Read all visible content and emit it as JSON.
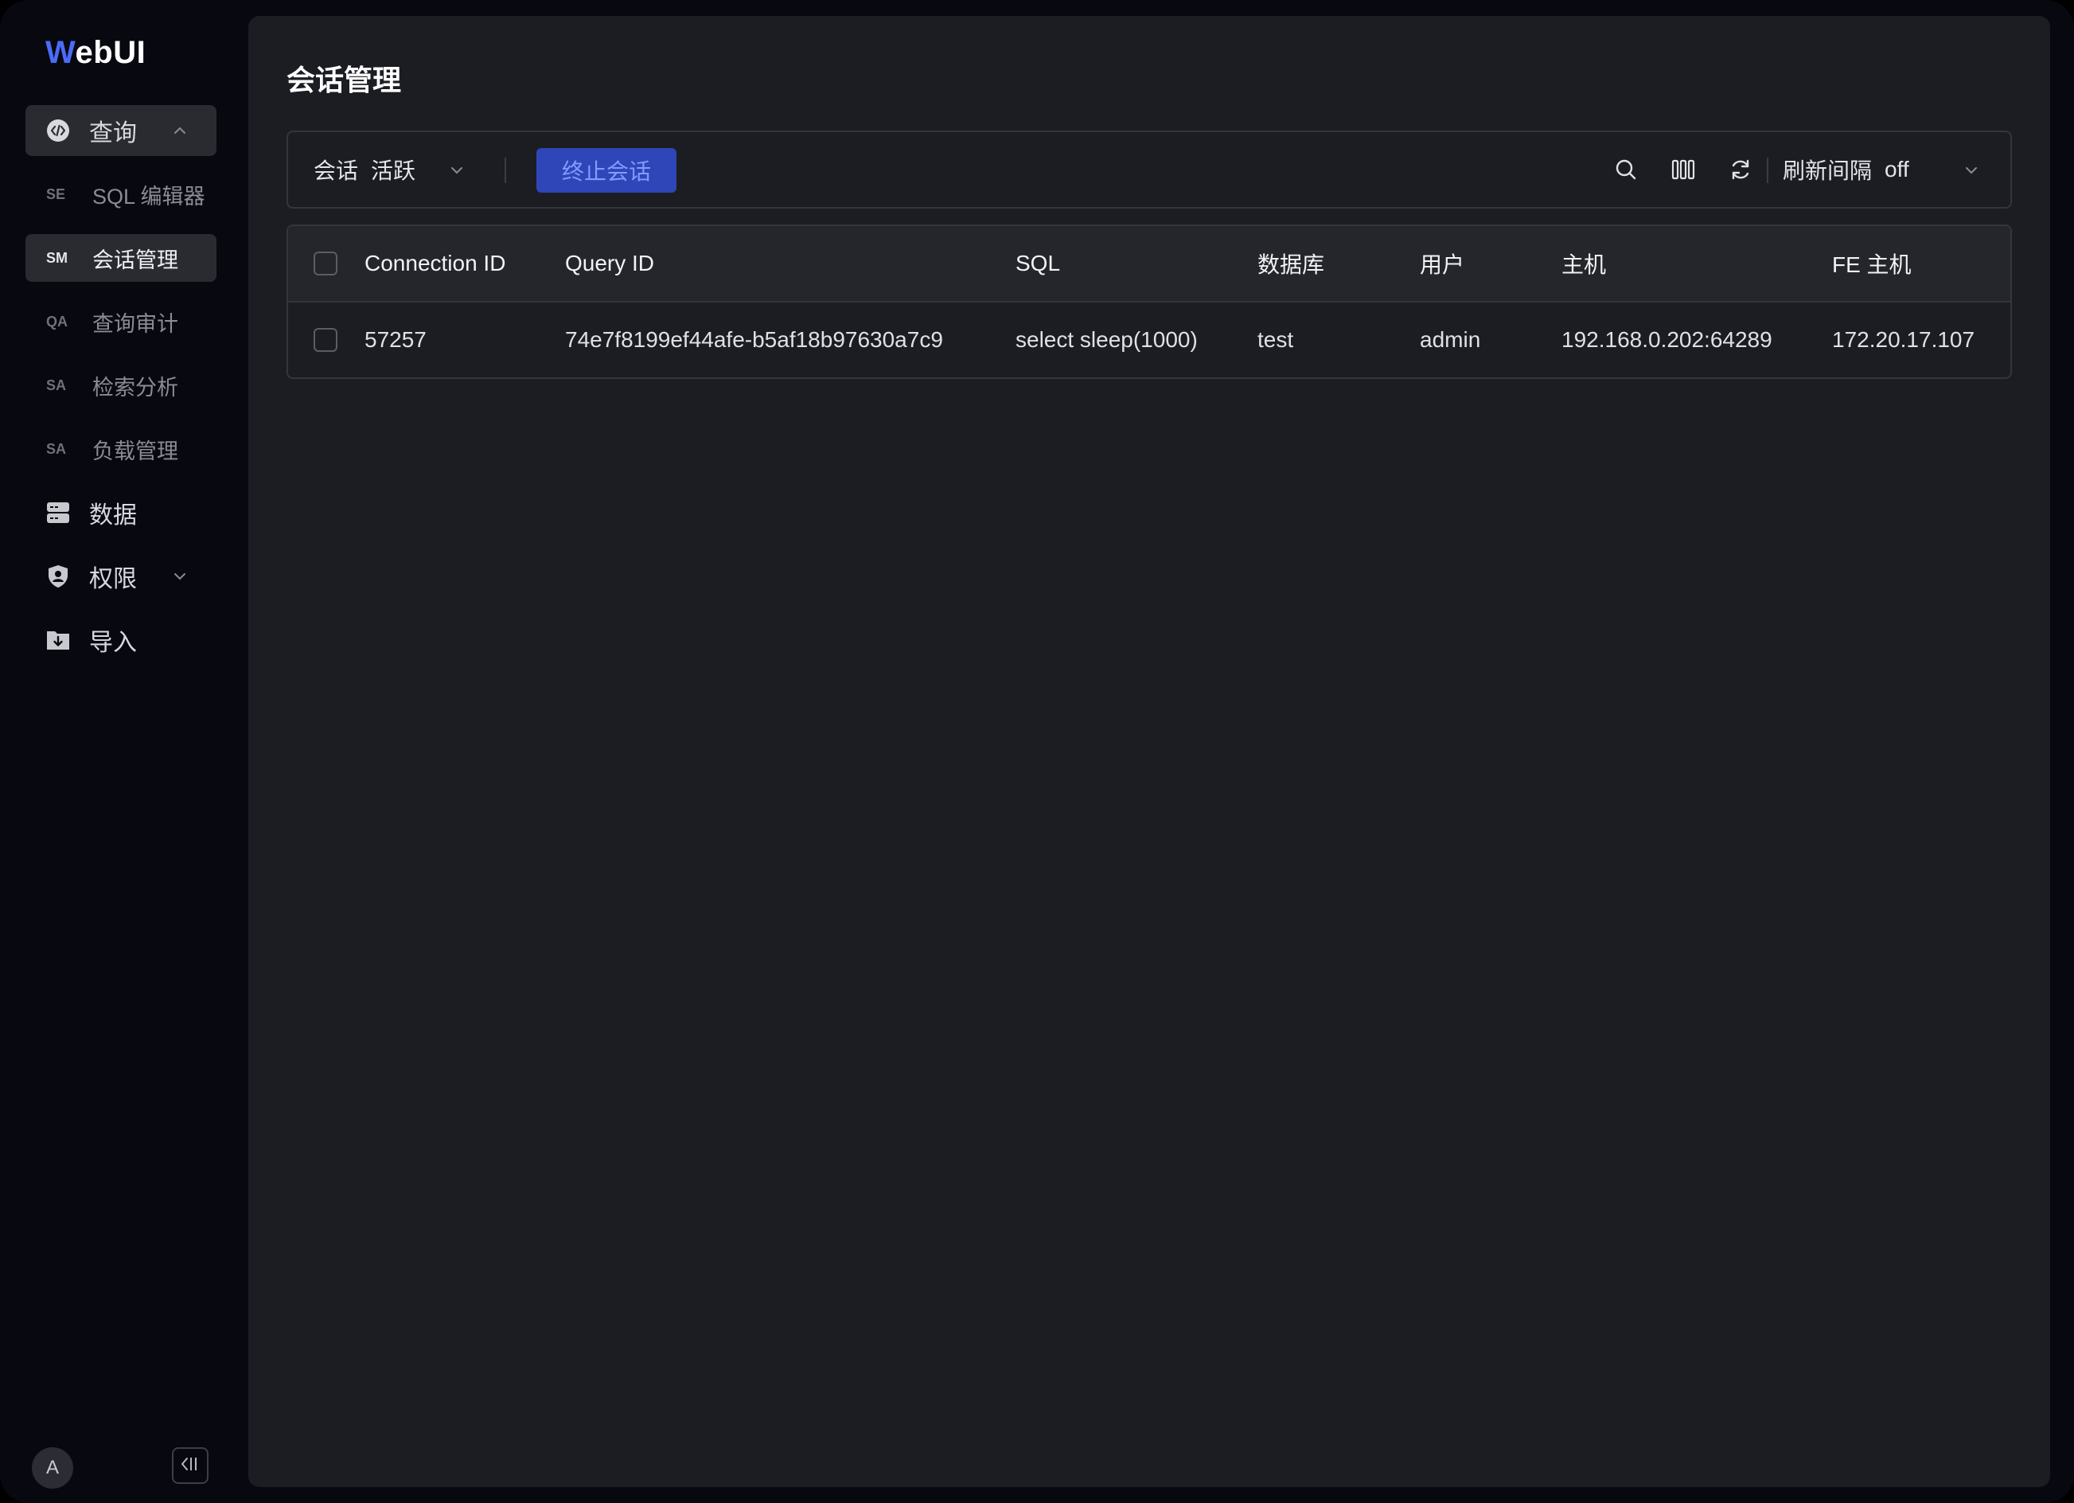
{
  "app": {
    "logo_first": "W",
    "logo_rest": "ebUI"
  },
  "sidebar": {
    "query": {
      "label": "查询"
    },
    "sub_items": [
      {
        "abbr": "SE",
        "label": "SQL 编辑器"
      },
      {
        "abbr": "SM",
        "label": "会话管理"
      },
      {
        "abbr": "QA",
        "label": "查询审计"
      },
      {
        "abbr": "SA",
        "label": "检索分析"
      },
      {
        "abbr": "SA",
        "label": "负载管理"
      }
    ],
    "data": {
      "label": "数据"
    },
    "permissions": {
      "label": "权限"
    },
    "import": {
      "label": "导入"
    },
    "avatar_initial": "A"
  },
  "page": {
    "title": "会话管理"
  },
  "toolbar": {
    "filter_label": "会话",
    "filter_value": "活跃",
    "kill_button": "终止会话",
    "refresh_label": "刷新间隔",
    "refresh_value": "off"
  },
  "table": {
    "columns": [
      "Connection ID",
      "Query ID",
      "SQL",
      "数据库",
      "用户",
      "主机",
      "FE 主机"
    ],
    "rows": [
      [
        "57257",
        "74e7f8199ef44afe-b5af18b97630a7c9",
        "select sleep(1000)",
        "test",
        "admin",
        "192.168.0.202:64289",
        "172.20.17.107"
      ]
    ]
  },
  "colors": {
    "accent": "#4a6cf7",
    "button_bg": "#2f46b8",
    "button_text": "#7f9cff"
  }
}
